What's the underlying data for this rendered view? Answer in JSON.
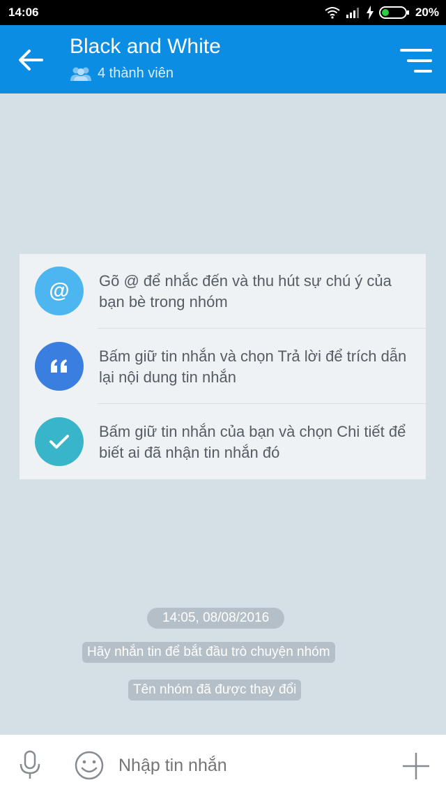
{
  "status_bar": {
    "time": "14:06",
    "battery": "20%"
  },
  "header": {
    "title": "Black and White",
    "subtitle": "4 thành viên"
  },
  "tips": [
    {
      "icon_name": "at-sign-icon",
      "icon_text": "@",
      "color": "#4db6f0",
      "text": "Gõ @ để nhắc đến và thu hút sự chú ý của bạn bè trong nhóm"
    },
    {
      "icon_name": "quote-icon",
      "icon_text": "“",
      "color": "#3a7ee0",
      "text": "Bấm giữ tin nhắn và chọn Trả lời để trích dẫn lại nội dung tin nhắn"
    },
    {
      "icon_name": "check-icon",
      "icon_text": "",
      "color": "#38b5c9",
      "text": "Bấm giữ tin nhắn của bạn và chọn Chi tiết để biết ai đã nhận tin nhắn đó"
    }
  ],
  "system_messages": {
    "timestamp": "14:05, 08/08/2016",
    "start_hint": "Hãy nhắn tin để bắt đầu trò chuyện nhóm",
    "rename_notice": "Tên nhóm đã được thay đổi"
  },
  "composer": {
    "placeholder": "Nhập tin nhắn"
  },
  "colors": {
    "header_bg": "#0a8de3",
    "chat_bg": "#d4dfe6",
    "pill_bg": "#b4bfc8"
  }
}
